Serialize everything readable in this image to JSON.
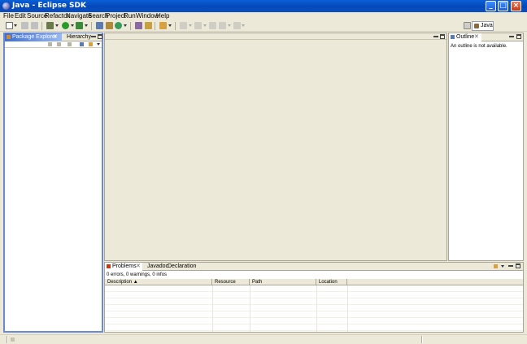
{
  "window": {
    "title": "Java - Eclipse SDK"
  },
  "menu": [
    "File",
    "Edit",
    "Source",
    "Refactor",
    "Navigate",
    "Search",
    "Project",
    "Run",
    "Window",
    "Help"
  ],
  "perspective": {
    "label": "Java"
  },
  "package_view": {
    "tabs": [
      {
        "label": "Package Explorer",
        "active": true
      },
      {
        "label": "Hierarchy",
        "active": false
      }
    ]
  },
  "outline_view": {
    "tab": "Outline",
    "message": "An outline is not available."
  },
  "problems_view": {
    "tabs": [
      "Problems",
      "Javadoc",
      "Declaration"
    ],
    "summary": "0 errors, 0 warnings, 0 infos",
    "columns": [
      "Description",
      "Resource",
      "Path",
      "Location"
    ]
  },
  "colors": {
    "titlebar": "#0548b8",
    "active_tab": "#3c6fd4",
    "chrome": "#ece9d8"
  }
}
